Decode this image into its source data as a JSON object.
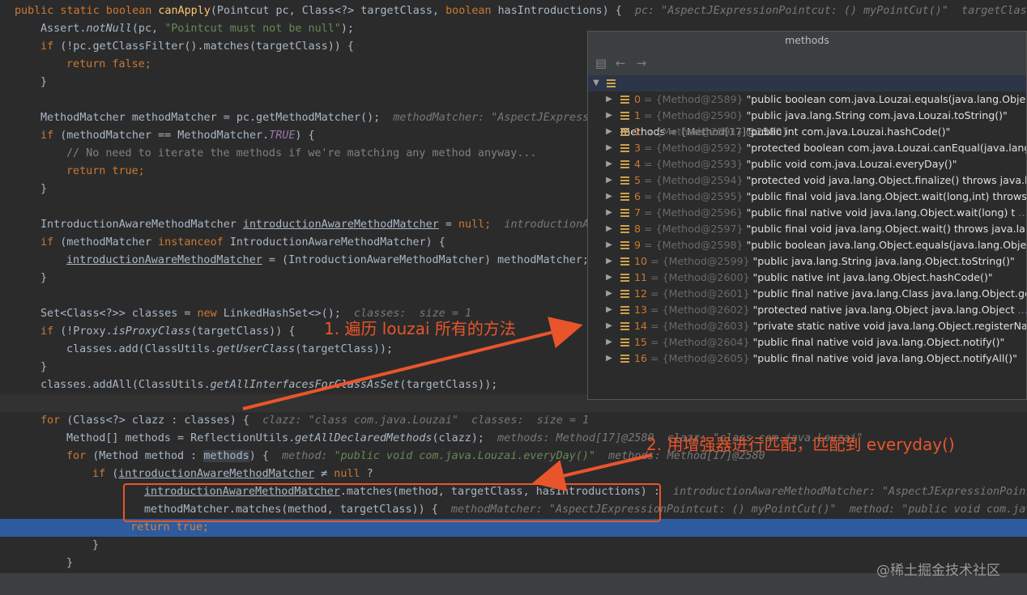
{
  "popup": {
    "title": "methods",
    "root": {
      "name": "methods",
      "value": "= {Method[17]@2580}"
    },
    "items": [
      {
        "index": "0",
        "ref": "{Method@2589}",
        "value": "\"public boolean com.java.Louzai.equals(java.lang.Object)\"",
        "view": ""
      },
      {
        "index": "1",
        "ref": "{Method@2590}",
        "value": "\"public java.lang.String com.java.Louzai.toString()\"",
        "view": ""
      },
      {
        "index": "2",
        "ref": "{Method@2591}",
        "value": "\"public int com.java.Louzai.hashCode()\"",
        "view": ""
      },
      {
        "index": "3",
        "ref": "{Method@2592}",
        "value": "\"protected boolean com.java.Louzai.canEqual(java.lang.Ob",
        "view": ""
      },
      {
        "index": "4",
        "ref": "{Method@2593}",
        "value": "\"public void com.java.Louzai.everyDay()\"",
        "view": ""
      },
      {
        "index": "5",
        "ref": "{Method@2594}",
        "value": "\"protected void java.lang.Object.finalize() throws java.lang",
        "view": ""
      },
      {
        "index": "6",
        "ref": "{Method@2595}",
        "value": "\"public final void java.lang.Object.wait(long,int) throws jav",
        "view": ""
      },
      {
        "index": "7",
        "ref": "{Method@2596}",
        "value": "\"public final native void java.lang.Object.wait(long) t",
        "view": "... View"
      },
      {
        "index": "8",
        "ref": "{Method@2597}",
        "value": "\"public final void java.lang.Object.wait() throws java.lang.In",
        "view": ""
      },
      {
        "index": "9",
        "ref": "{Method@2598}",
        "value": "\"public boolean java.lang.Object.equals(java.lang.Object)\"",
        "view": ""
      },
      {
        "index": "10",
        "ref": "{Method@2599}",
        "value": "\"public java.lang.String java.lang.Object.toString()\"",
        "view": ""
      },
      {
        "index": "11",
        "ref": "{Method@2600}",
        "value": "\"public native int java.lang.Object.hashCode()\"",
        "view": ""
      },
      {
        "index": "12",
        "ref": "{Method@2601}",
        "value": "\"public final native java.lang.Class java.lang.Object.getCla",
        "view": ""
      },
      {
        "index": "13",
        "ref": "{Method@2602}",
        "value": "\"protected native java.lang.Object java.lang.Object",
        "view": "... View"
      },
      {
        "index": "14",
        "ref": "{Method@2603}",
        "value": "\"private static native void java.lang.Object.registerNatives",
        "view": ""
      },
      {
        "index": "15",
        "ref": "{Method@2604}",
        "value": "\"public final native void java.lang.Object.notify()\"",
        "view": ""
      },
      {
        "index": "16",
        "ref": "{Method@2605}",
        "value": "\"public final native void java.lang.Object.notifyAll()\"",
        "view": ""
      }
    ]
  },
  "annotations": {
    "a1": "1. 遍历 louzai 所有的方法",
    "a2": "2. 用增强器进行匹配，匹配到 everyday()"
  },
  "watermark": "@稀土掘金技术社区",
  "colors": {
    "annotation": "#e8552b",
    "highlight_line": "#2d5b9e",
    "editor_bg": "#2b2b2b"
  }
}
